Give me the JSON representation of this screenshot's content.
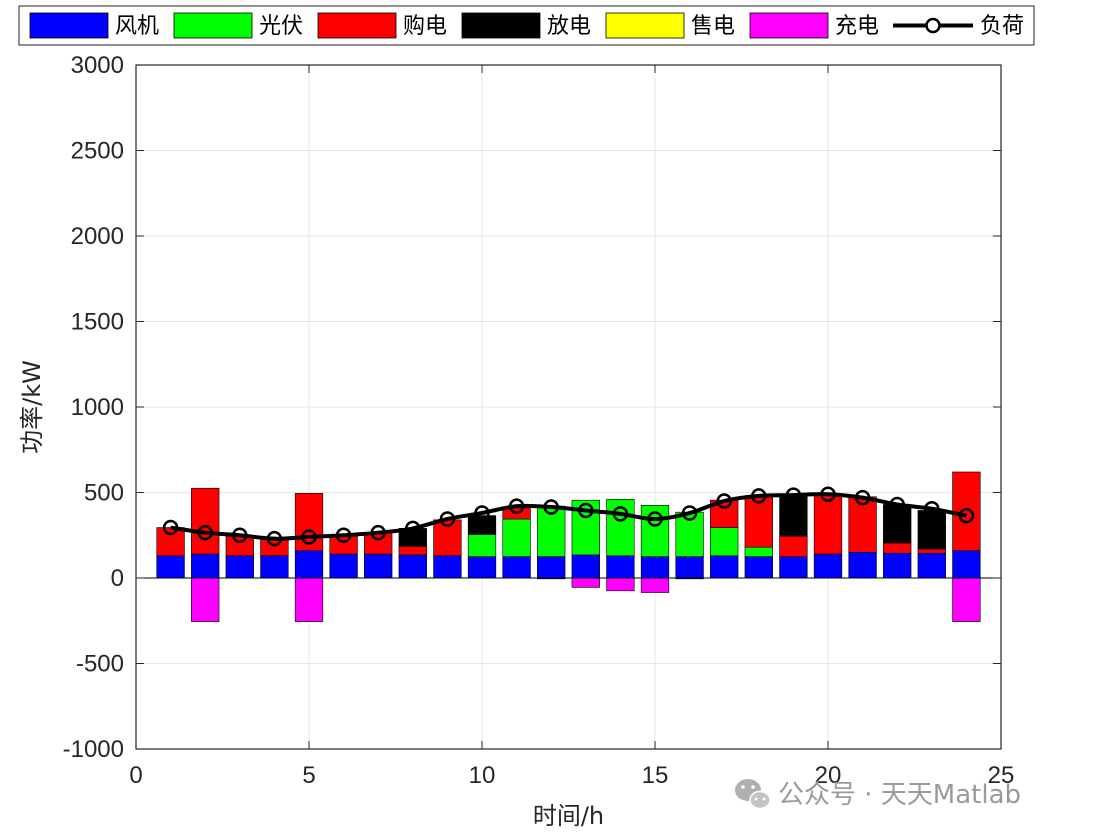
{
  "chart_data": {
    "type": "bar",
    "title": "",
    "xlabel": "时间/h",
    "ylabel": "功率/kW",
    "xlim": [
      0,
      25
    ],
    "ylim": [
      -1000,
      3000
    ],
    "xticks": [
      0,
      5,
      10,
      15,
      20,
      25
    ],
    "yticks": [
      -1000,
      -500,
      0,
      500,
      1000,
      1500,
      2000,
      2500,
      3000
    ],
    "grid": true,
    "legend_position": "top",
    "stacked": true,
    "x": [
      1,
      2,
      3,
      4,
      5,
      6,
      7,
      8,
      9,
      10,
      11,
      12,
      13,
      14,
      15,
      16,
      17,
      18,
      19,
      20,
      21,
      22,
      23,
      24
    ],
    "series": [
      {
        "name": "风机",
        "color": "#0000ff",
        "values": [
          130,
          140,
          130,
          130,
          160,
          140,
          140,
          135,
          130,
          125,
          125,
          125,
          135,
          130,
          125,
          125,
          130,
          125,
          125,
          140,
          150,
          145,
          145,
          160
        ]
      },
      {
        "name": "光伏",
        "color": "#00ff00",
        "values": [
          0,
          0,
          0,
          0,
          0,
          0,
          0,
          0,
          0,
          130,
          220,
          295,
          320,
          330,
          300,
          260,
          165,
          55,
          0,
          0,
          0,
          0,
          0,
          0
        ]
      },
      {
        "name": "购电",
        "color": "#ff0000",
        "values": [
          165,
          385,
          115,
          95,
          335,
          105,
          125,
          50,
          210,
          0,
          65,
          0,
          0,
          0,
          0,
          0,
          160,
          300,
          120,
          350,
          325,
          60,
          25,
          460
        ]
      },
      {
        "name": "放电",
        "color": "#000000",
        "values": [
          0,
          0,
          0,
          0,
          0,
          0,
          0,
          105,
          0,
          110,
          0,
          0,
          0,
          0,
          0,
          0,
          0,
          0,
          230,
          0,
          0,
          225,
          225,
          0
        ]
      },
      {
        "name": "售电",
        "color": "#ffff00",
        "values": [
          0,
          0,
          0,
          0,
          0,
          0,
          0,
          0,
          0,
          0,
          0,
          0,
          0,
          0,
          0,
          0,
          0,
          0,
          0,
          0,
          0,
          0,
          0,
          0
        ]
      },
      {
        "name": "充电",
        "color": "#ff00ff",
        "values": [
          0,
          -255,
          0,
          0,
          -255,
          0,
          0,
          0,
          0,
          0,
          0,
          -5,
          -55,
          -75,
          -85,
          -5,
          0,
          0,
          0,
          0,
          0,
          0,
          0,
          -255
        ]
      }
    ],
    "line_series": {
      "name": "负荷",
      "color": "#000000",
      "marker": "circle",
      "values": [
        295,
        265,
        250,
        230,
        240,
        250,
        265,
        290,
        345,
        380,
        420,
        415,
        395,
        375,
        345,
        380,
        450,
        480,
        485,
        490,
        470,
        430,
        405,
        365
      ]
    }
  },
  "watermark": {
    "icon": "wechat-icon",
    "text": "公众号 · 天天Matlab"
  }
}
